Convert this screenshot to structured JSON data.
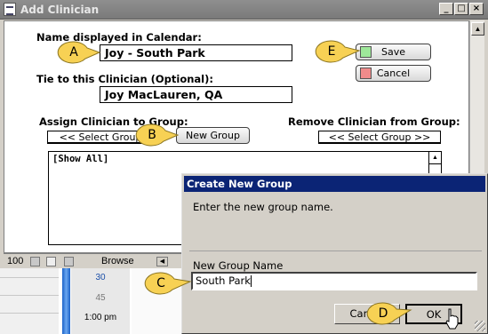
{
  "window": {
    "title": "Add Clinician",
    "controls": {
      "minimize": "_",
      "maximize": "□",
      "close": "×"
    }
  },
  "form": {
    "name_label": "Name displayed in Calendar:",
    "name_value": "Joy - South Park",
    "tie_label": "Tie to this Clinician (Optional):",
    "tie_value": "Joy MacLauren, QA",
    "assign_label": "Assign Clinician to Group:",
    "assign_select": "<< Select Group",
    "new_group_label": "New Group",
    "remove_label": "Remove Clinician from Group:",
    "remove_select": "<< Select Group >>",
    "save_label": "Save",
    "cancel_label": "Cancel",
    "save_color": "#9ee89a",
    "cancel_color": "#ef8b8b"
  },
  "group_list": {
    "items": [
      "[Show All]"
    ]
  },
  "status_bar": {
    "zoom": "100",
    "mode": "Browse"
  },
  "calendar": {
    "times": [
      "30",
      "45",
      "1:00 pm"
    ]
  },
  "dialog": {
    "title": "Create New Group",
    "prompt": "Enter the new group name.",
    "field_label": "New Group Name",
    "field_value": "South Park",
    "cancel_label": "Cancel",
    "ok_label": "OK"
  },
  "callouts": [
    "A",
    "B",
    "C",
    "D",
    "E"
  ],
  "colors": {
    "callout_fill": "#f7d154",
    "dialog_title_bg": "#0b2475",
    "calendar_bar": "#1b62c8"
  }
}
